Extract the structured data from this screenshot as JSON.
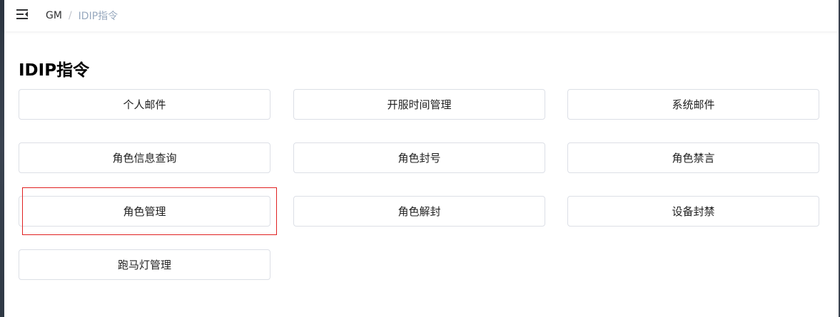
{
  "breadcrumb": {
    "root": "GM",
    "separator": "/",
    "current": "IDIP指令"
  },
  "page": {
    "title": "IDIP指令"
  },
  "commands": [
    {
      "label": "个人邮件"
    },
    {
      "label": "开服时间管理"
    },
    {
      "label": "系统邮件"
    },
    {
      "label": "角色信息查询"
    },
    {
      "label": "角色封号"
    },
    {
      "label": "角色禁言"
    },
    {
      "label": "角色管理"
    },
    {
      "label": "角色解封"
    },
    {
      "label": "设备封禁"
    },
    {
      "label": "跑马灯管理"
    }
  ],
  "colors": {
    "highlight_border": "#e02020",
    "button_border": "#dcdfe6",
    "breadcrumb_current": "#97a8be"
  },
  "icons": {
    "menu_toggle": "hamburger-fold-icon"
  }
}
